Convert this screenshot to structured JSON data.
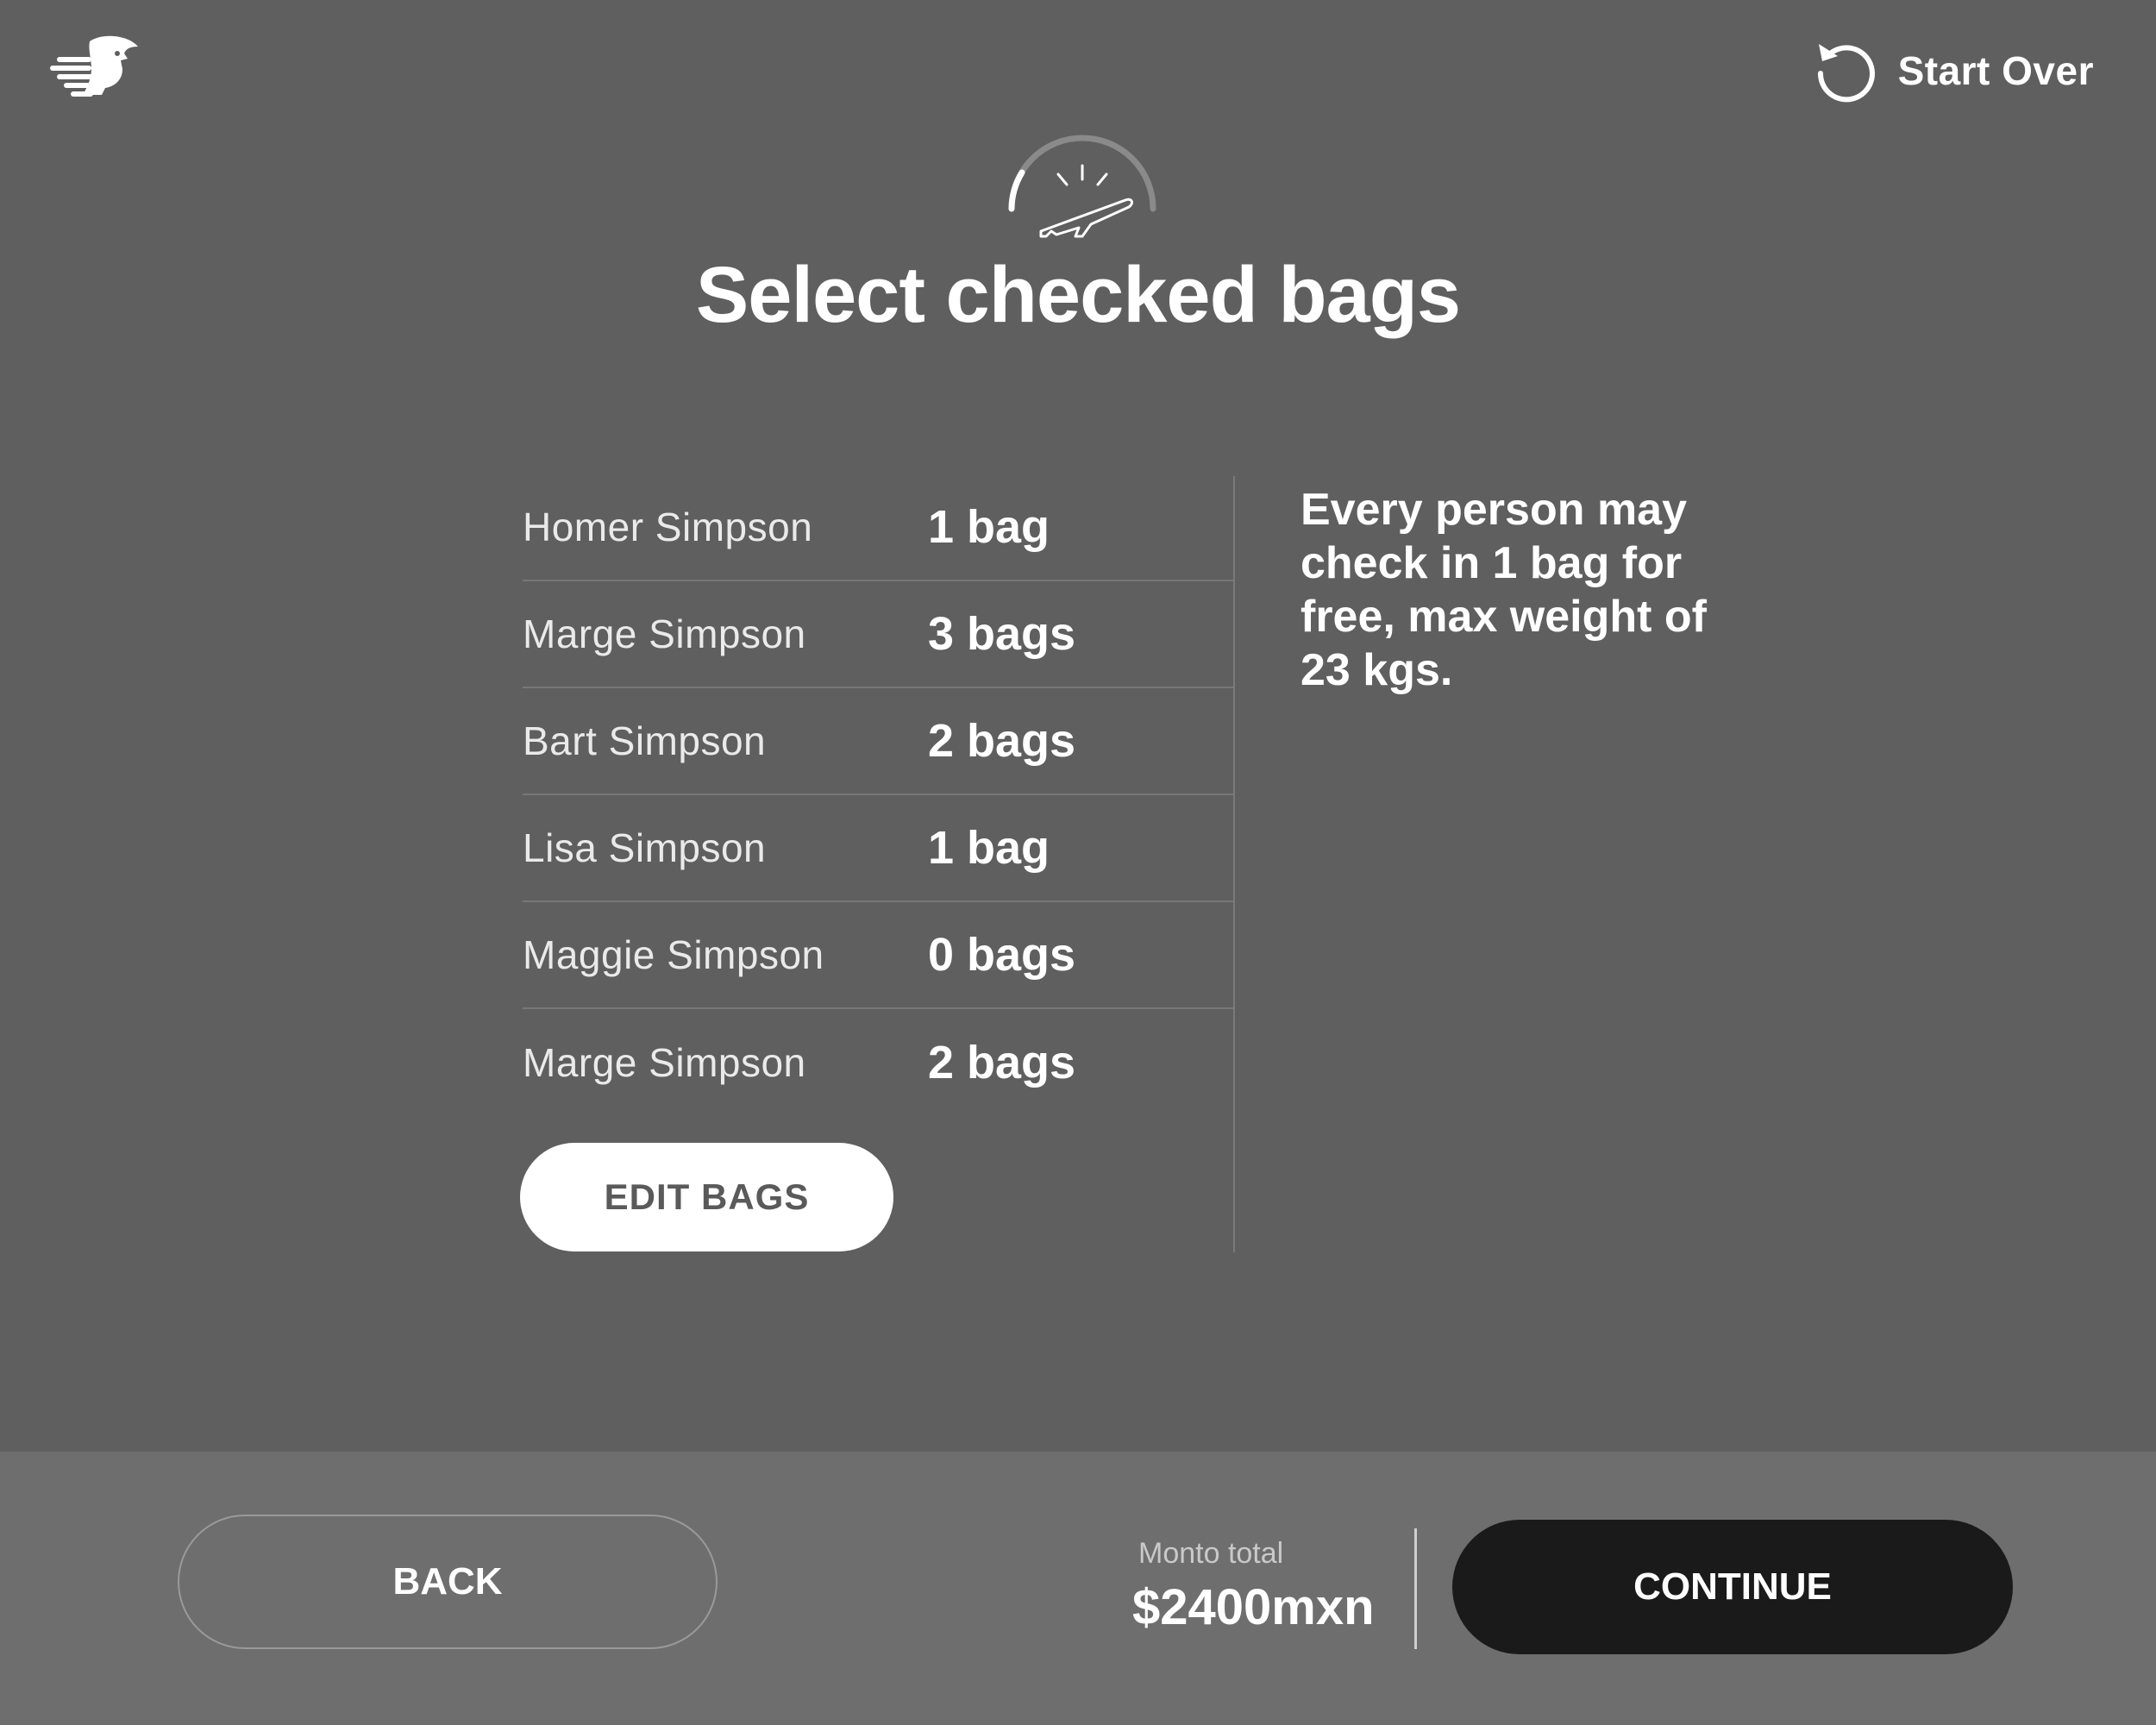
{
  "header": {
    "logo_icon": "eagle-logo-icon",
    "start_over_icon": "restart-icon",
    "start_over_label": "Start Over"
  },
  "page": {
    "progress_icon": "plane-takeoff-progress-icon",
    "title": "Select checked bags"
  },
  "bags": [
    {
      "name": "Homer Simpson",
      "count": "1 bag"
    },
    {
      "name": "Marge Simpson",
      "count": "3 bags"
    },
    {
      "name": "Bart Simpson",
      "count": "2 bags"
    },
    {
      "name": "Lisa Simpson",
      "count": "1 bag"
    },
    {
      "name": "Maggie Simpson",
      "count": "0 bags"
    },
    {
      "name": "Marge Simpson",
      "count": "2 bags"
    }
  ],
  "edit_bags_label": "EDIT  BAGS",
  "info_text": "Every person may check in 1 bag for free, max weight of 23 kgs.",
  "footer": {
    "back_label": "BACK",
    "total_label": "Monto total",
    "total_value": "$2400mxn",
    "continue_label": "CONTINUE"
  },
  "colors": {
    "background": "#5f5f5f",
    "footer": "#6e6e6e",
    "continue_button": "#1a1a1a",
    "edit_button": "#ffffff"
  }
}
